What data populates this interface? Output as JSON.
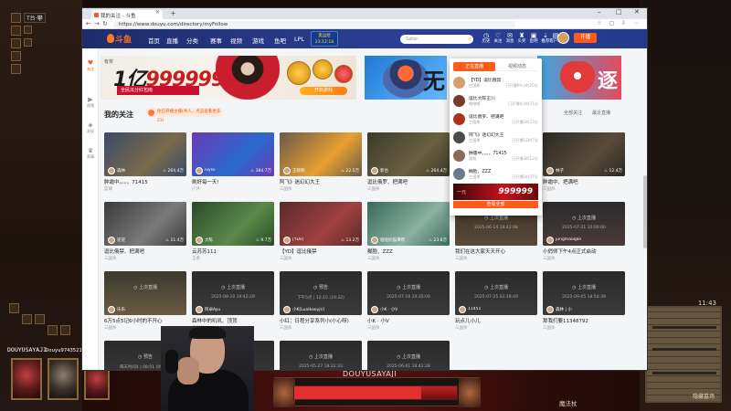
{
  "browser": {
    "tab_title": "我的关注 - 斗鱼",
    "url": "https://www.douyu.com/directory/myFollow"
  },
  "nav": {
    "logo": "斗鱼",
    "items": [
      "首页",
      "直播",
      "分类",
      "赛事",
      "视频",
      "游戏",
      "鱼吧",
      "LPL"
    ],
    "promo_top": "奥运组",
    "promo_bottom": "23:12:18",
    "search_placeholder": "Sator",
    "icons": [
      {
        "glyph": "◷",
        "label": "历史"
      },
      {
        "glyph": "♡",
        "label": "关注"
      },
      {
        "glyph": "✉",
        "label": "消息"
      },
      {
        "glyph": "♜",
        "label": "头奖"
      },
      {
        "glyph": "▣",
        "label": "鱼吧"
      },
      {
        "glyph": "⇣",
        "label": "推荐"
      },
      {
        "glyph": "▤",
        "label": "客户端"
      }
    ],
    "start_button": "开播"
  },
  "sidebar": {
    "items": [
      {
        "glyph": "♥",
        "label": "关注"
      },
      {
        "glyph": "▶",
        "label": "视频"
      },
      {
        "glyph": "◈",
        "label": "发现"
      },
      {
        "glyph": "♛",
        "label": "赛事"
      }
    ]
  },
  "banners": {
    "b1_tag": "有奖",
    "b1_number_a": "1亿",
    "b1_number_b": "999999",
    "b1_sub": "全民瓜分红包雨",
    "b1_button": "开启游戏",
    "b2_text": "无",
    "b3_text": "逐"
  },
  "section": {
    "title": "我的关注",
    "notice": "你已开播主播(共人，点击查看更多 23)",
    "sort_1": "全部关注",
    "sort_2": "最近直播"
  },
  "popup": {
    "tab_live": "正在直播",
    "tab_video": "视频动态",
    "items": [
      {
        "name": "【YD】逗比俄禁",
        "status": "三国杀",
        "time": "已开播09小时20分",
        "color": "#d8a068"
      },
      {
        "name": "逗比大陈王川",
        "status": "哈哈哈",
        "time": "已开播0小时21分",
        "color": "#7a3a2a"
      },
      {
        "name": "逗比俄罗、把满吧",
        "status": "三国杀",
        "time": "已开播1时23分",
        "color": "#b03020"
      },
      {
        "name": "阿飞》迷幻幻大王",
        "status": "三国杀",
        "time": "已开播12时7分",
        "color": "#4a4a4a"
      },
      {
        "name": "肿霜中。。。。71415",
        "status": "游戏",
        "time": "已开播3时12分",
        "color": "#8a6a5a"
      },
      {
        "name": "糊脸、ZZZ",
        "status": "三国杀",
        "time": "已开播1时37分",
        "color": "#6a7a8a"
      }
    ],
    "banner_label": "一元",
    "banner_number": "999999",
    "view_all": "查看全部"
  },
  "cards": [
    {
      "name": "森林",
      "hot": "264.4万",
      "title": "肿霜中。。。。71415",
      "cat": "篮球",
      "live": true,
      "bg": "#3a4a6a",
      "bg2": "#7a6a4a"
    },
    {
      "name": "ivysv",
      "hot": "384.7万",
      "title": "刷好每一天!",
      "cat": "户外",
      "live": true,
      "bg": "#6a3ab0",
      "bg2": "#2a6ad0"
    },
    {
      "name": "王晓明",
      "hot": "22.5万",
      "title": "阿飞》迷幻幻大王",
      "cat": "三国杀",
      "live": true,
      "bg": "#6a5a4a",
      "bg2": "#e8a030"
    },
    {
      "name": "新台",
      "hot": "264.4万",
      "title": "逗比俄罗、把满吧",
      "cat": "三国杀",
      "live": true,
      "bg": "#3a3a2a",
      "bg2": "#6a6040"
    },
    {
      "name": "王大陈",
      "hot": "22.5万",
      "title": "逗比大陈王川",
      "cat": "三国杀",
      "live": true,
      "bg": "#4a3a2a",
      "bg2": "#a07040"
    },
    {
      "name": "林子",
      "hot": "12.4万",
      "title": "肿霜中、把满吧",
      "cat": "三国杀",
      "live": true,
      "bg": "#2a2a24",
      "bg2": "#5a4a3a"
    },
    {
      "name": "逆逆",
      "hot": "11.4万",
      "title": "逗比俄禁、把满吧",
      "cat": "三国杀",
      "live": true,
      "bg": "#3a3a3a",
      "bg2": "#7a7a7a"
    },
    {
      "name": "大陈",
      "hot": "9.7万",
      "title": "云苏苏111",
      "cat": "王者",
      "live": true,
      "bg": "#2a4a2a",
      "bg2": "#5a8a4a"
    },
    {
      "name": "[YDx]",
      "hot": "13.2万",
      "title": "【YD】逗比俄禁",
      "cat": "三国杀",
      "live": true,
      "bg": "#5a2a2a",
      "bg2": "#a04040"
    },
    {
      "name": "哑哑奶猫薄荷",
      "hot": "23.8万",
      "title": "糊脸、ZZZ",
      "cat": "三国杀",
      "live": true,
      "bg": "#3a6a5a",
      "bg2": "#8ab0a0"
    },
    {
      "name": "",
      "hot": "",
      "title": "我们在这大家天天开心",
      "cat": "三国杀",
      "live": false,
      "off": "上次直播",
      "time": "2025-06-14 18:42:08",
      "bg": "#3a3228",
      "bg2": "#5a4a38"
    },
    {
      "name": "jungmaoqan",
      "hot": "",
      "title": "小俏师下午4点正式启动",
      "cat": "三国杀",
      "live": false,
      "off": "上次直播",
      "time": "2025-07-21 10:00:00",
      "bg": "#2a2a2a",
      "bg2": "#4a3a3a"
    },
    {
      "name": "乐乐",
      "hot": "",
      "title": "6万5点5记6小时的不开心",
      "cat": "三国杀",
      "live": false,
      "off": "上次直播",
      "time": "",
      "bg": "#3a3a30",
      "bg2": "#6a5a40"
    },
    {
      "name": "阿卓Ayu",
      "hot": "",
      "title": "森林中的叽叽、顶顶",
      "cat": "三国杀",
      "live": false,
      "off": "上次直播",
      "time": "2025-08-10 19:42:29",
      "bg": "#2a2a2a",
      "bg2": "#3a3a3a"
    },
    {
      "name": "小K[Luolkaoyjn]",
      "hot": "",
      "title": "小红：日程分享系列小(小心呀)",
      "cat": "三国杀",
      "live": false,
      "off": "预告",
      "time": "下午5点 | 12:15 (19:22)",
      "bg": "#2a2a2a",
      "bg2": "#3a3a3a"
    },
    {
      "name": "小K · 小V",
      "hot": "",
      "title": "小K · 小V",
      "cat": "三国杀",
      "live": false,
      "off": "上次直播",
      "time": "2025-07-10 20:35:08",
      "bg": "#2a2a2a",
      "bg2": "#3a3a3a"
    },
    {
      "name": "11451",
      "hot": "",
      "title": "玩点儿小儿",
      "cat": "三国杀",
      "live": false,
      "off": "上次直播",
      "time": "2025-07-25 02:19:49",
      "bg": "#2a2a2a",
      "bg2": "#3a3a3a"
    },
    {
      "name": "森林 | 小",
      "hot": "",
      "title": "那我们要11348792",
      "cat": "三国杀",
      "live": false,
      "off": "上次直播",
      "time": "2025-09-05 18:54:39",
      "bg": "#2a2a2a",
      "bg2": "#3a3a3a"
    },
    {
      "name": "猫猫dw",
      "hot": "",
      "title": "第一把决大9万分享",
      "cat": "三国杀",
      "live": false,
      "off": "预告",
      "time": "每天时间4 | 08:01 (09:32)",
      "bg": "#2a2a2a",
      "bg2": "#3a3a3a"
    },
    {
      "name": "",
      "hot": "",
      "title": "",
      "cat": "",
      "live": false,
      "off": "上次直播",
      "time": "2025-02-23 23:44:01",
      "bg": "#2a2a2a",
      "bg2": "#3a3a3a"
    },
    {
      "name": "",
      "hot": "",
      "title": "",
      "cat": "",
      "live": false,
      "off": "上次直播",
      "time": "2025-05-27 18:22:33",
      "bg": "#2a2a2a",
      "bg2": "#3a3a3a"
    },
    {
      "name": "",
      "hot": "",
      "title": "",
      "cat": "",
      "live": false,
      "off": "上次直播",
      "time": "2025-06-01 18:42:28",
      "bg": "#2a2a2a",
      "bg2": "#3a3a3a"
    }
  ],
  "game": {
    "top_tag": "T台·攀",
    "player1": "DOUYUSAYAJI",
    "player2": "Douyu9743521",
    "hero_name": "DOUYUSAYAJI",
    "minimap_time": "11:43",
    "minimap_name": "隐藏墓场",
    "skill_name": "魔法杖",
    "hp_fraction": 0.78
  }
}
